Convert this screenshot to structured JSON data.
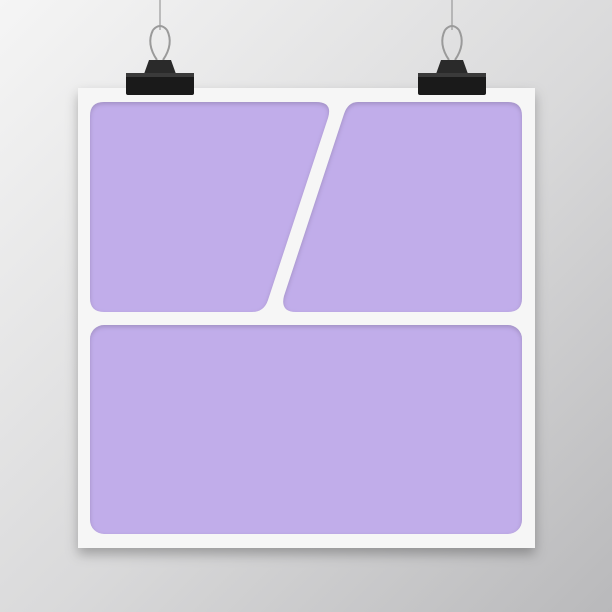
{
  "colors": {
    "wall_light": "#f4f4f4",
    "wall_dark": "#bdbdbf",
    "sheet": "#f6f6f6",
    "panel": "#c1adea",
    "panel_shadow": "#a897cc",
    "clip_body": "#1a1a1a",
    "clip_wire": "#9a9a9a"
  },
  "icons": {
    "left_clip": "binder-clip-icon",
    "right_clip": "binder-clip-icon"
  },
  "collage": {
    "panel_count": 3
  }
}
